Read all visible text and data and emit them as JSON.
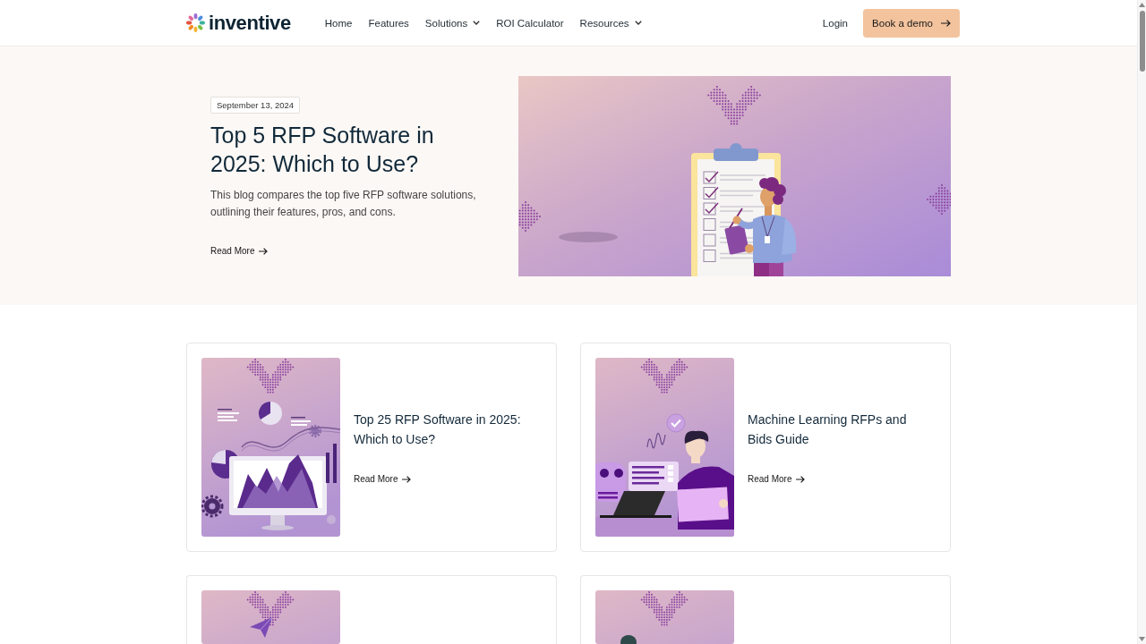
{
  "header": {
    "logo": {
      "text": "inventive"
    },
    "nav": [
      {
        "label": "Home",
        "dropdown": false
      },
      {
        "label": "Features",
        "dropdown": false
      },
      {
        "label": "Solutions",
        "dropdown": true
      },
      {
        "label": "ROI Calculator",
        "dropdown": false
      },
      {
        "label": "Resources",
        "dropdown": true
      }
    ],
    "login": "Login",
    "cta": "Book a demo"
  },
  "hero": {
    "date": "September 13, 2024",
    "title": "Top 5 RFP Software in 2025: Which to Use?",
    "summary": "This blog compares the top five RFP software solutions, outlining their features, pros, and cons.",
    "link": "Read More"
  },
  "cards": [
    {
      "kind": "dashboard",
      "title": "Top 25 RFP Software in 2025: Which to Use?",
      "link": "Read More"
    },
    {
      "kind": "assistant",
      "title": "Machine Learning RFPs and Bids Guide",
      "link": "Read More"
    },
    {
      "kind": "plane"
    },
    {
      "kind": "figure"
    }
  ]
}
